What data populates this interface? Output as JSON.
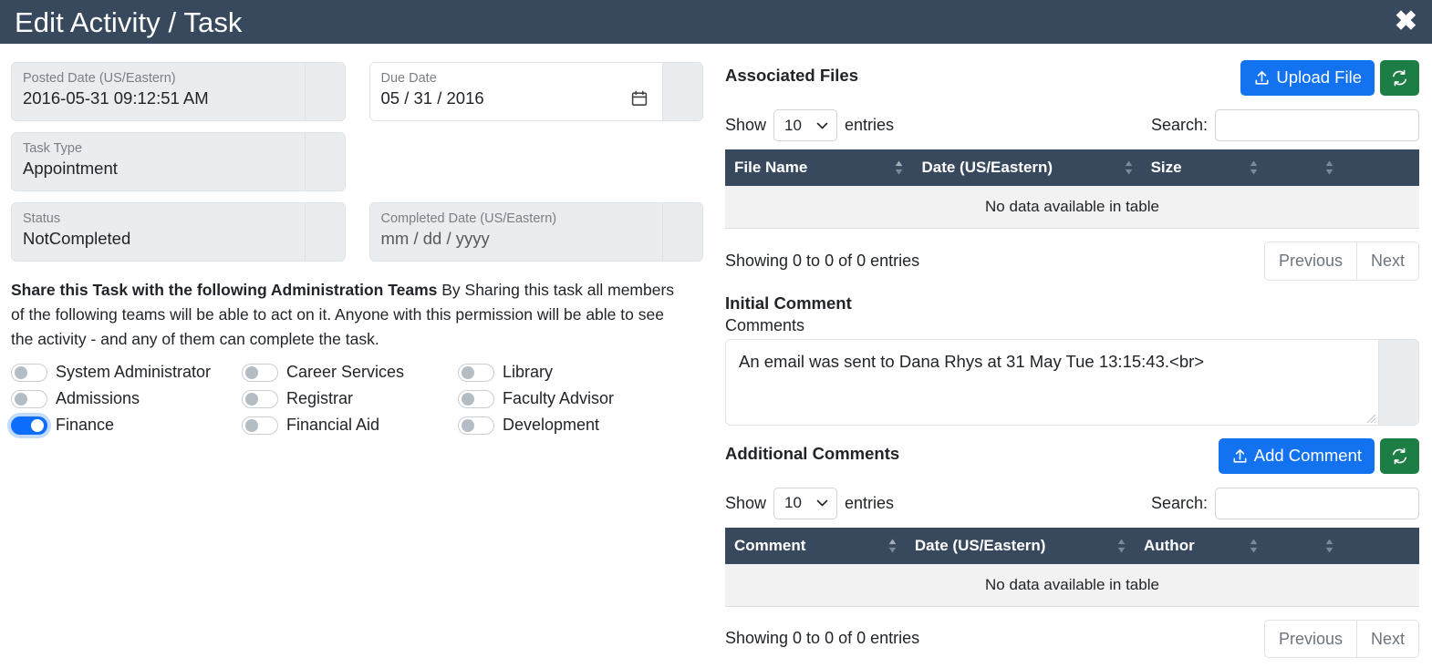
{
  "header": {
    "title": "Edit Activity / Task",
    "close_icon": "close-icon",
    "bg_color": "#38495e"
  },
  "left": {
    "fields": [
      {
        "label": "Posted Date (US/Eastern)",
        "value": "2016-05-31 09:12:51 AM",
        "enabled": false,
        "has_calendar": false
      },
      {
        "label": "Due Date",
        "value": "05 / 31 / 2016",
        "enabled": true,
        "has_calendar": true
      },
      {
        "label": "Task Type",
        "value": "Appointment",
        "enabled": false,
        "has_calendar": false
      },
      {
        "label": "Status",
        "value": "NotCompleted",
        "enabled": false,
        "has_calendar": false
      },
      {
        "label": "Completed Date (US/Eastern)",
        "value": "mm / dd / yyyy",
        "enabled": false,
        "has_calendar": false
      }
    ],
    "share": {
      "heading": "Share this Task with the following Administration Teams",
      "body": " By Sharing this task all members of the following teams will be able to act on it. Anyone with this permission will be able to see the activity - and any of them can complete the task."
    },
    "teams": [
      {
        "label": "System Administrator",
        "on": false
      },
      {
        "label": "Career Services",
        "on": false
      },
      {
        "label": "Library",
        "on": false
      },
      {
        "label": "Admissions",
        "on": false
      },
      {
        "label": "Registrar",
        "on": false
      },
      {
        "label": "Faculty Advisor",
        "on": false
      },
      {
        "label": "Finance",
        "on": true
      },
      {
        "label": "Financial Aid",
        "on": false
      },
      {
        "label": "Development",
        "on": false
      }
    ]
  },
  "files_section": {
    "title": "Associated Files",
    "upload_label": "Upload File",
    "upload_icon": "upload-icon",
    "refresh_icon": "refresh-icon",
    "show_label": "Show",
    "entries_label": "entries",
    "page_length": "10",
    "search_label": "Search:",
    "search_value": "",
    "search_placeholder": "",
    "columns": [
      "File Name",
      "Date (US/Eastern)",
      "Size",
      "",
      ""
    ],
    "empty_message": "No data available in table",
    "info": "Showing 0 to 0 of 0 entries",
    "previous_label": "Previous",
    "next_label": "Next"
  },
  "initial_comment": {
    "title": "Initial Comment",
    "field_label": "Comments",
    "value": "An email was sent to Dana Rhys at 31 May Tue 13:15:43.<br>"
  },
  "comments_section": {
    "title": "Additional Comments",
    "add_label": "Add Comment",
    "add_icon": "upload-icon",
    "refresh_icon": "refresh-icon",
    "show_label": "Show",
    "entries_label": "entries",
    "page_length": "10",
    "search_label": "Search:",
    "search_value": "",
    "search_placeholder": "",
    "columns": [
      "Comment",
      "Date (US/Eastern)",
      "Author",
      "",
      ""
    ],
    "empty_message": "No data available in table",
    "info": "Showing 0 to 0 of 0 entries",
    "previous_label": "Previous",
    "next_label": "Next"
  },
  "colors": {
    "header_bg": "#38495e",
    "primary": "#1272f0",
    "success": "#1d7e45",
    "toggle_on": "#0d6efd",
    "table_header": "#38495e"
  }
}
